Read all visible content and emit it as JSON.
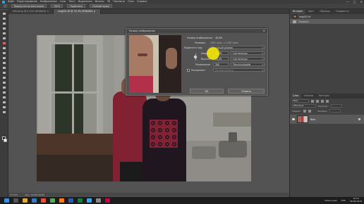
{
  "menubar": {
    "items": [
      "Файл",
      "Редактирование",
      "Изображение",
      "Слои",
      "Текст",
      "Выделение",
      "Фильтр",
      "3D",
      "Просмотр",
      "Окно",
      "Справка"
    ],
    "controls": [
      "—",
      "▢",
      "✕"
    ]
  },
  "options": {
    "scroll_all": "Прокрутка во всех окнах",
    "zoom_value": "100%",
    "fit_label": "Подогнать",
    "fullscreen_label": "Полный экран"
  },
  "document_tabs": [
    {
      "label": "IMG.bmp @ 4,25% (RGB/8#) ×",
      "active": false
    },
    {
      "label": "img002.tif @ 33,3% (RGB/8#) ×",
      "active": true
    }
  ],
  "status": {
    "zoom": "33,33%",
    "doc": "Док: 18,6М/18,6М"
  },
  "right_panel": {
    "top_tabs": [
      "История",
      "Цвет",
      "Образцы",
      "Градиенты"
    ],
    "history_items": [
      {
        "label": "img002.tif",
        "selected": false
      },
      {
        "label": "Открыть",
        "selected": true
      }
    ],
    "layer_tabs": [
      "Слои",
      "Каналы",
      "Контуры"
    ],
    "layer_filter": "Вид",
    "blend_mode": "Обычные",
    "opacity_label": "Непрозр.:",
    "fill_label": "Заливка:",
    "lock_label": "Закреп.:",
    "layers": [
      {
        "name": "Фон",
        "visible": true
      }
    ]
  },
  "dialog": {
    "title": "Размер изображения",
    "size_label": "Размер изображения:",
    "size_value": "48,9М",
    "dims_label": "Размеры:",
    "dims_value": "2581 пикс. × 2287 пикс.",
    "fit_label": "Подогнать под:",
    "fit_value": "Исходный размер",
    "width_label": "Ширина:",
    "width_value": "21,76",
    "width_unit": "Сантиметры",
    "height_label": "Высота:",
    "height_value": "19,39",
    "height_unit": "Сантиметры",
    "res_label": "Разрешение:",
    "res_value": "300",
    "res_unit": "Пикселы/дюйм",
    "resample_label": "Ресамплинг:",
    "resample_value": "Автоматически",
    "ok_label": "OK",
    "cancel_label": "Отмена",
    "close_glyph": "✕"
  },
  "taskbar": {
    "lang": "RUS",
    "time": "19:10",
    "date": "06.06.2019",
    "tray_text": "Бликсонии"
  },
  "colors": {
    "accent": "#2fa3e8",
    "cursor_highlight": "#fff000",
    "dress_red": "#b83046"
  }
}
